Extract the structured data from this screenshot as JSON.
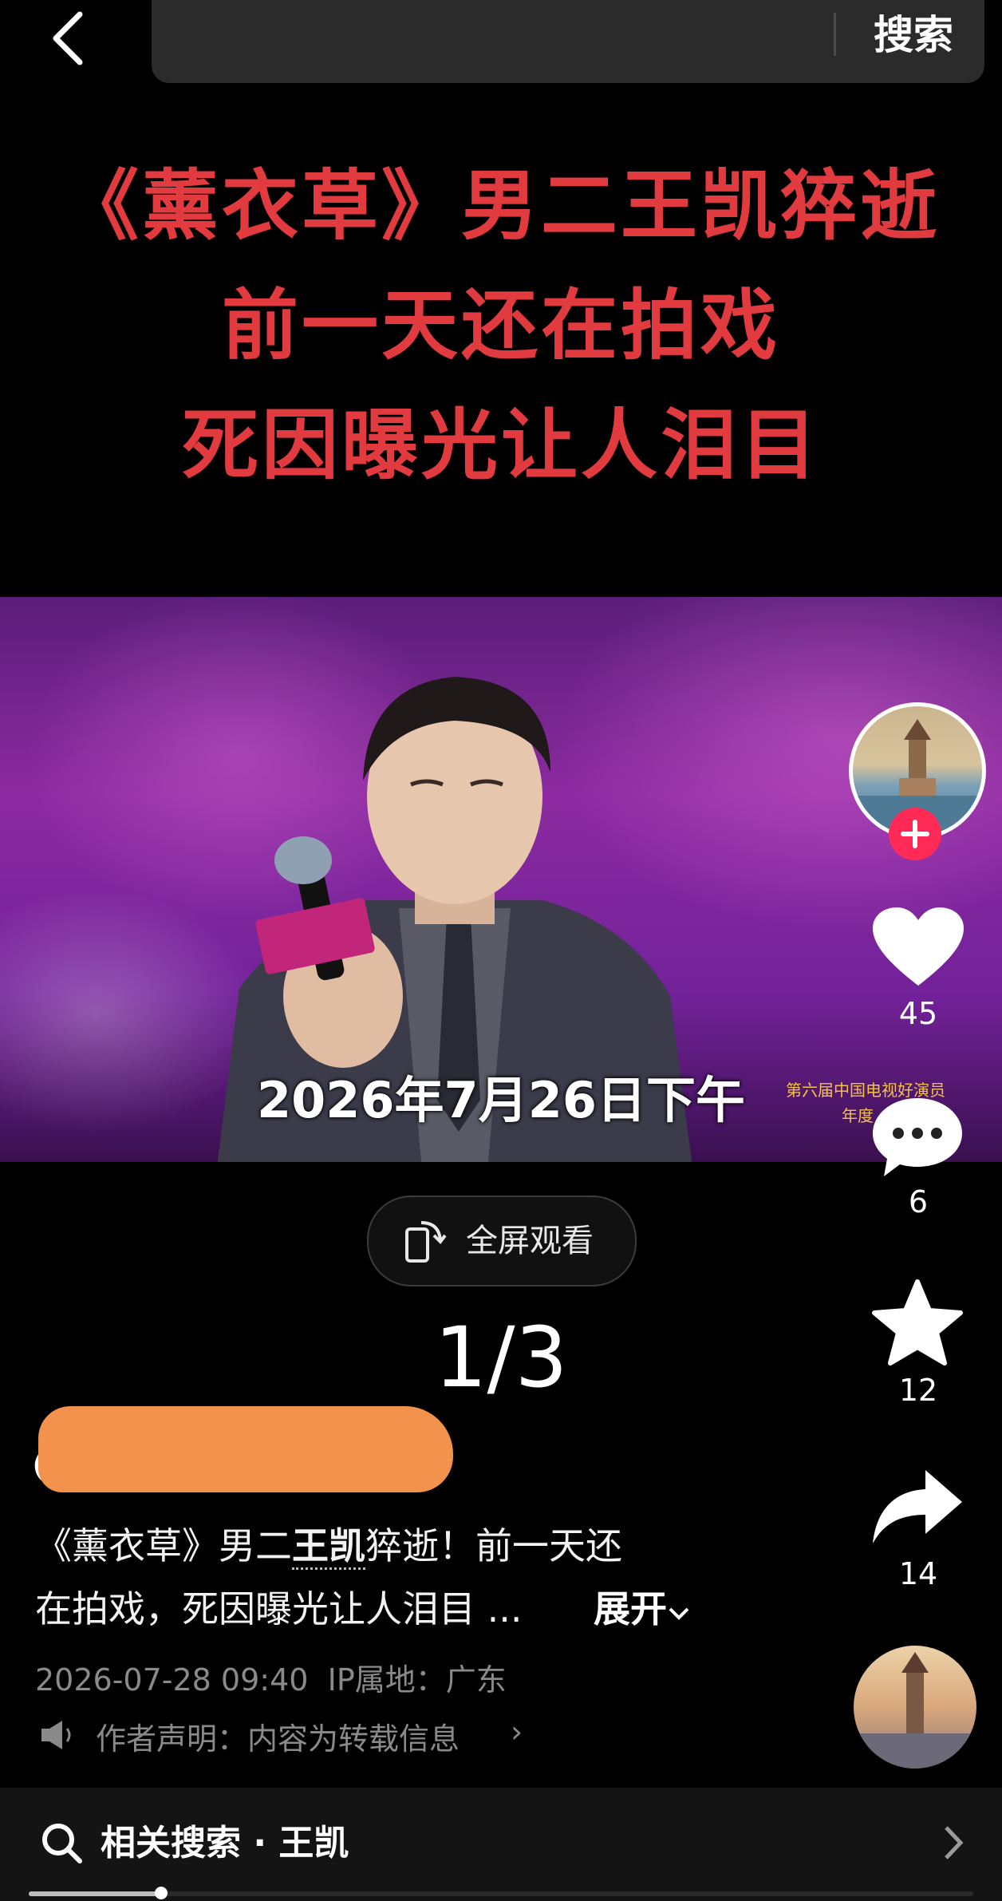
{
  "search": {
    "button_label": "搜索"
  },
  "headline": {
    "line1": "《薰衣草》男二王凯猝逝",
    "line2": "前一天还在拍戏",
    "line3": "死因曝光让人泪目"
  },
  "video": {
    "caption": "2026年7月26日下午",
    "side_caption_1": "第六届中国电视好演员",
    "side_caption_2": "年度"
  },
  "actions": {
    "likes": "45",
    "comments": "6",
    "favorites": "12",
    "shares": "14"
  },
  "fullscreen_label": "全屏观看",
  "pager": "1/3",
  "post": {
    "author_prefix": "@",
    "desc_line1_a": "《薰衣草》男二",
    "desc_keyword": "王凯",
    "desc_line1_b": "猝逝！前一天还",
    "desc_line2": "在拍戏，死因曝光让人泪目 ...",
    "expand_label": "展开",
    "timestamp": "2026-07-28 09:40",
    "ip_location": "IP属地：广东",
    "author_notice": "作者声明：内容为转载信息"
  },
  "related_search": {
    "label": "相关搜索 · 王凯"
  },
  "progress": {
    "fraction": 0.14
  },
  "colors": {
    "headline_red": "#e13a3f",
    "follow_pink": "#ff2a55",
    "redaction_orange": "#f2924d"
  },
  "icons": [
    "back-chevron-icon",
    "heart-icon",
    "comment-icon",
    "star-icon",
    "share-icon",
    "fullscreen-rotate-icon",
    "megaphone-icon",
    "search-icon",
    "chevron-right-icon",
    "plus-icon"
  ]
}
